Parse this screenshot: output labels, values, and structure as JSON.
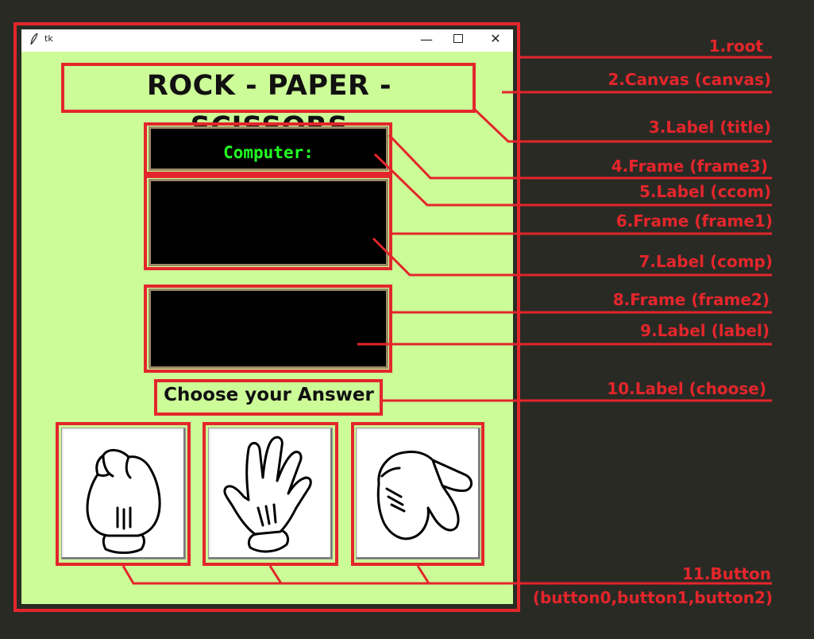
{
  "window": {
    "title": "tk",
    "controls": {
      "minimize": "—",
      "close": "✕"
    }
  },
  "app": {
    "title_label": "ROCK - PAPER - SCISSORS",
    "computer_label": "Computer:",
    "choose_label": "Choose your Answer",
    "buttons": [
      {
        "name": "button0",
        "icon": "rock-hand-icon"
      },
      {
        "name": "button1",
        "icon": "paper-hand-icon"
      },
      {
        "name": "button2",
        "icon": "scissors-hand-icon"
      }
    ]
  },
  "annotations": [
    "1.root",
    "2.Canvas (canvas)",
    "3.Label (title)",
    "4.Frame (frame3)",
    "5.Label (ccom)",
    "6.Frame (frame1)",
    "7.Label (comp)",
    "8.Frame (frame2)",
    "9.Label (label)",
    "10.Label (choose)",
    "11.Button",
    "(button0,button1,button2)"
  ],
  "colors": {
    "annotation_red": "#e3262b",
    "canvas_green": "#ccfc97",
    "panel_black": "#000000",
    "computer_text_green": "#22ff22",
    "background": "#2a2a25"
  }
}
